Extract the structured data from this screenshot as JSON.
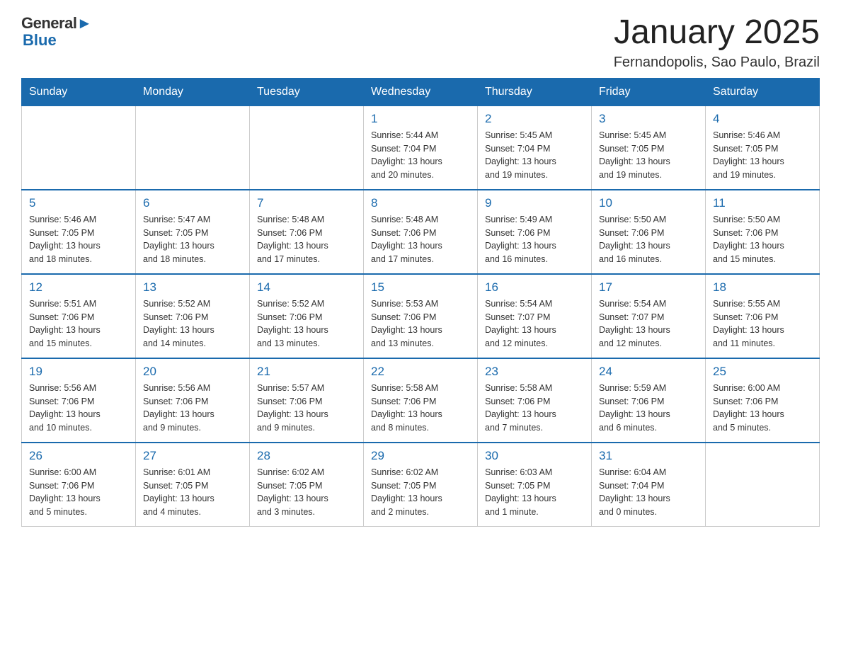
{
  "header": {
    "logo_general": "General",
    "logo_blue": "Blue",
    "title": "January 2025",
    "subtitle": "Fernandopolis, Sao Paulo, Brazil"
  },
  "days_of_week": [
    "Sunday",
    "Monday",
    "Tuesday",
    "Wednesday",
    "Thursday",
    "Friday",
    "Saturday"
  ],
  "weeks": [
    [
      {
        "day": "",
        "info": ""
      },
      {
        "day": "",
        "info": ""
      },
      {
        "day": "",
        "info": ""
      },
      {
        "day": "1",
        "info": "Sunrise: 5:44 AM\nSunset: 7:04 PM\nDaylight: 13 hours\nand 20 minutes."
      },
      {
        "day": "2",
        "info": "Sunrise: 5:45 AM\nSunset: 7:04 PM\nDaylight: 13 hours\nand 19 minutes."
      },
      {
        "day": "3",
        "info": "Sunrise: 5:45 AM\nSunset: 7:05 PM\nDaylight: 13 hours\nand 19 minutes."
      },
      {
        "day": "4",
        "info": "Sunrise: 5:46 AM\nSunset: 7:05 PM\nDaylight: 13 hours\nand 19 minutes."
      }
    ],
    [
      {
        "day": "5",
        "info": "Sunrise: 5:46 AM\nSunset: 7:05 PM\nDaylight: 13 hours\nand 18 minutes."
      },
      {
        "day": "6",
        "info": "Sunrise: 5:47 AM\nSunset: 7:05 PM\nDaylight: 13 hours\nand 18 minutes."
      },
      {
        "day": "7",
        "info": "Sunrise: 5:48 AM\nSunset: 7:06 PM\nDaylight: 13 hours\nand 17 minutes."
      },
      {
        "day": "8",
        "info": "Sunrise: 5:48 AM\nSunset: 7:06 PM\nDaylight: 13 hours\nand 17 minutes."
      },
      {
        "day": "9",
        "info": "Sunrise: 5:49 AM\nSunset: 7:06 PM\nDaylight: 13 hours\nand 16 minutes."
      },
      {
        "day": "10",
        "info": "Sunrise: 5:50 AM\nSunset: 7:06 PM\nDaylight: 13 hours\nand 16 minutes."
      },
      {
        "day": "11",
        "info": "Sunrise: 5:50 AM\nSunset: 7:06 PM\nDaylight: 13 hours\nand 15 minutes."
      }
    ],
    [
      {
        "day": "12",
        "info": "Sunrise: 5:51 AM\nSunset: 7:06 PM\nDaylight: 13 hours\nand 15 minutes."
      },
      {
        "day": "13",
        "info": "Sunrise: 5:52 AM\nSunset: 7:06 PM\nDaylight: 13 hours\nand 14 minutes."
      },
      {
        "day": "14",
        "info": "Sunrise: 5:52 AM\nSunset: 7:06 PM\nDaylight: 13 hours\nand 13 minutes."
      },
      {
        "day": "15",
        "info": "Sunrise: 5:53 AM\nSunset: 7:06 PM\nDaylight: 13 hours\nand 13 minutes."
      },
      {
        "day": "16",
        "info": "Sunrise: 5:54 AM\nSunset: 7:07 PM\nDaylight: 13 hours\nand 12 minutes."
      },
      {
        "day": "17",
        "info": "Sunrise: 5:54 AM\nSunset: 7:07 PM\nDaylight: 13 hours\nand 12 minutes."
      },
      {
        "day": "18",
        "info": "Sunrise: 5:55 AM\nSunset: 7:06 PM\nDaylight: 13 hours\nand 11 minutes."
      }
    ],
    [
      {
        "day": "19",
        "info": "Sunrise: 5:56 AM\nSunset: 7:06 PM\nDaylight: 13 hours\nand 10 minutes."
      },
      {
        "day": "20",
        "info": "Sunrise: 5:56 AM\nSunset: 7:06 PM\nDaylight: 13 hours\nand 9 minutes."
      },
      {
        "day": "21",
        "info": "Sunrise: 5:57 AM\nSunset: 7:06 PM\nDaylight: 13 hours\nand 9 minutes."
      },
      {
        "day": "22",
        "info": "Sunrise: 5:58 AM\nSunset: 7:06 PM\nDaylight: 13 hours\nand 8 minutes."
      },
      {
        "day": "23",
        "info": "Sunrise: 5:58 AM\nSunset: 7:06 PM\nDaylight: 13 hours\nand 7 minutes."
      },
      {
        "day": "24",
        "info": "Sunrise: 5:59 AM\nSunset: 7:06 PM\nDaylight: 13 hours\nand 6 minutes."
      },
      {
        "day": "25",
        "info": "Sunrise: 6:00 AM\nSunset: 7:06 PM\nDaylight: 13 hours\nand 5 minutes."
      }
    ],
    [
      {
        "day": "26",
        "info": "Sunrise: 6:00 AM\nSunset: 7:06 PM\nDaylight: 13 hours\nand 5 minutes."
      },
      {
        "day": "27",
        "info": "Sunrise: 6:01 AM\nSunset: 7:05 PM\nDaylight: 13 hours\nand 4 minutes."
      },
      {
        "day": "28",
        "info": "Sunrise: 6:02 AM\nSunset: 7:05 PM\nDaylight: 13 hours\nand 3 minutes."
      },
      {
        "day": "29",
        "info": "Sunrise: 6:02 AM\nSunset: 7:05 PM\nDaylight: 13 hours\nand 2 minutes."
      },
      {
        "day": "30",
        "info": "Sunrise: 6:03 AM\nSunset: 7:05 PM\nDaylight: 13 hours\nand 1 minute."
      },
      {
        "day": "31",
        "info": "Sunrise: 6:04 AM\nSunset: 7:04 PM\nDaylight: 13 hours\nand 0 minutes."
      },
      {
        "day": "",
        "info": ""
      }
    ]
  ],
  "colors": {
    "header_bg": "#1a6aad",
    "header_text": "#ffffff",
    "day_number_color": "#1a6aad",
    "border_color": "#cccccc",
    "row_separator": "#1a6aad"
  }
}
